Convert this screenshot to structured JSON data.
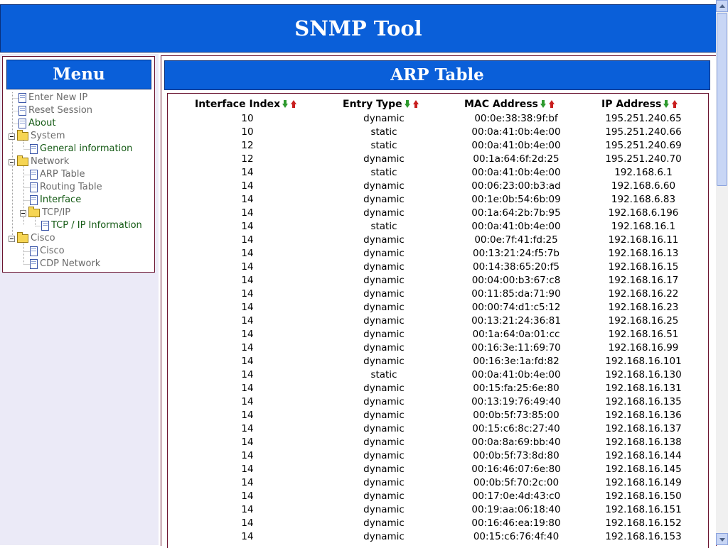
{
  "header": {
    "title": "SNMP Tool"
  },
  "menu": {
    "title": "Menu",
    "items": [
      {
        "label": "Enter New IP",
        "type": "doc",
        "level": 0,
        "color": "gray"
      },
      {
        "label": "Reset Session",
        "type": "doc",
        "level": 0,
        "color": "gray"
      },
      {
        "label": "About",
        "type": "doc",
        "level": 0,
        "color": "green"
      },
      {
        "label": "System",
        "type": "folder",
        "level": 0,
        "color": "gray"
      },
      {
        "label": "General information",
        "type": "doc",
        "level": 1,
        "color": "green"
      },
      {
        "label": "Network",
        "type": "folder",
        "level": 0,
        "color": "gray"
      },
      {
        "label": "ARP Table",
        "type": "doc",
        "level": 1,
        "color": "gray"
      },
      {
        "label": "Routing Table",
        "type": "doc",
        "level": 1,
        "color": "gray"
      },
      {
        "label": "Interface",
        "type": "doc",
        "level": 1,
        "color": "green"
      },
      {
        "label": "TCP/IP",
        "type": "folder",
        "level": 1,
        "color": "gray"
      },
      {
        "label": "TCP / IP Information",
        "type": "doc",
        "level": 2,
        "color": "green"
      },
      {
        "label": "Cisco",
        "type": "folder",
        "level": 0,
        "color": "gray"
      },
      {
        "label": "Cisco",
        "type": "doc",
        "level": 1,
        "color": "gray"
      },
      {
        "label": "CDP Network",
        "type": "doc",
        "level": 1,
        "color": "gray"
      }
    ]
  },
  "main": {
    "title": "ARP Table",
    "columns": [
      "Interface Index",
      "Entry Type",
      "MAC Address",
      "IP Address"
    ],
    "rows": [
      [
        "10",
        "dynamic",
        "00:0e:38:38:9f:bf",
        "195.251.240.65"
      ],
      [
        "10",
        "static",
        "00:0a:41:0b:4e:00",
        "195.251.240.66"
      ],
      [
        "12",
        "static",
        "00:0a:41:0b:4e:00",
        "195.251.240.69"
      ],
      [
        "12",
        "dynamic",
        "00:1a:64:6f:2d:25",
        "195.251.240.70"
      ],
      [
        "14",
        "static",
        "00:0a:41:0b:4e:00",
        "192.168.6.1"
      ],
      [
        "14",
        "dynamic",
        "00:06:23:00:b3:ad",
        "192.168.6.60"
      ],
      [
        "14",
        "dynamic",
        "00:1e:0b:54:6b:09",
        "192.168.6.83"
      ],
      [
        "14",
        "dynamic",
        "00:1a:64:2b:7b:95",
        "192.168.6.196"
      ],
      [
        "14",
        "static",
        "00:0a:41:0b:4e:00",
        "192.168.16.1"
      ],
      [
        "14",
        "dynamic",
        "00:0e:7f:41:fd:25",
        "192.168.16.11"
      ],
      [
        "14",
        "dynamic",
        "00:13:21:24:f5:7b",
        "192.168.16.13"
      ],
      [
        "14",
        "dynamic",
        "00:14:38:65:20:f5",
        "192.168.16.15"
      ],
      [
        "14",
        "dynamic",
        "00:04:00:b3:67:c8",
        "192.168.16.17"
      ],
      [
        "14",
        "dynamic",
        "00:11:85:da:71:90",
        "192.168.16.22"
      ],
      [
        "14",
        "dynamic",
        "00:00:74:d1:c5:12",
        "192.168.16.23"
      ],
      [
        "14",
        "dynamic",
        "00:13:21:24:36:81",
        "192.168.16.25"
      ],
      [
        "14",
        "dynamic",
        "00:1a:64:0a:01:cc",
        "192.168.16.51"
      ],
      [
        "14",
        "dynamic",
        "00:16:3e:11:69:70",
        "192.168.16.99"
      ],
      [
        "14",
        "dynamic",
        "00:16:3e:1a:fd:82",
        "192.168.16.101"
      ],
      [
        "14",
        "static",
        "00:0a:41:0b:4e:00",
        "192.168.16.130"
      ],
      [
        "14",
        "dynamic",
        "00:15:fa:25:6e:80",
        "192.168.16.131"
      ],
      [
        "14",
        "dynamic",
        "00:13:19:76:49:40",
        "192.168.16.135"
      ],
      [
        "14",
        "dynamic",
        "00:0b:5f:73:85:00",
        "192.168.16.136"
      ],
      [
        "14",
        "dynamic",
        "00:15:c6:8c:27:40",
        "192.168.16.137"
      ],
      [
        "14",
        "dynamic",
        "00:0a:8a:69:bb:40",
        "192.168.16.138"
      ],
      [
        "14",
        "dynamic",
        "00:0b:5f:73:8d:80",
        "192.168.16.144"
      ],
      [
        "14",
        "dynamic",
        "00:16:46:07:6e:80",
        "192.168.16.145"
      ],
      [
        "14",
        "dynamic",
        "00:0b:5f:70:2c:00",
        "192.168.16.149"
      ],
      [
        "14",
        "dynamic",
        "00:17:0e:4d:43:c0",
        "192.168.16.150"
      ],
      [
        "14",
        "dynamic",
        "00:19:aa:06:18:40",
        "192.168.16.151"
      ],
      [
        "14",
        "dynamic",
        "00:16:46:ea:19:80",
        "192.168.16.152"
      ],
      [
        "14",
        "dynamic",
        "00:15:c6:76:4f:40",
        "192.168.16.153"
      ]
    ]
  },
  "colors": {
    "accent": "#0a5fd9",
    "border": "#6b1430",
    "sidebar_bg": "#ebeaf7",
    "link_green": "#145a14",
    "link_gray": "#6b6b6b"
  },
  "icons": {
    "sort_desc": "green-down-arrow-icon",
    "sort_asc": "red-up-arrow-icon",
    "doc": "document-icon",
    "folder": "folder-icon"
  }
}
